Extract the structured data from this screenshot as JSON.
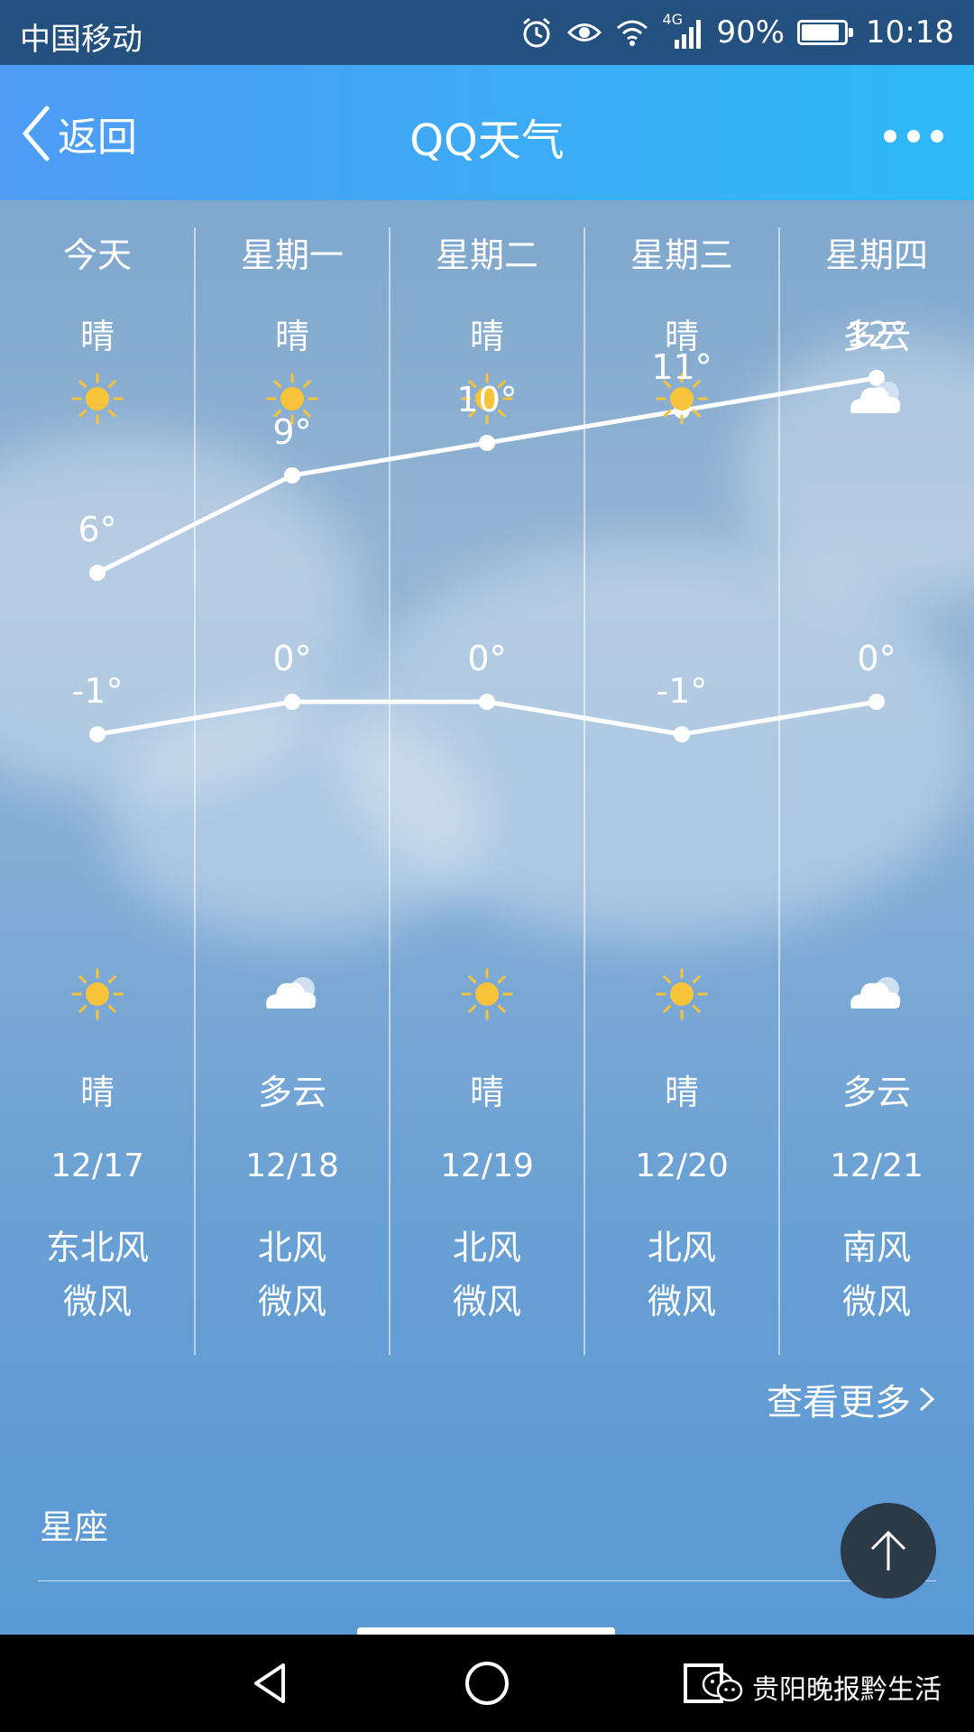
{
  "status_bar": {
    "carrier": "中国移动",
    "network": "4G",
    "battery": "90%",
    "battery_level": 0.9,
    "time": "10:18"
  },
  "app_bar": {
    "back_label": "返回",
    "title": "QQ天气"
  },
  "forecast": [
    {
      "day": "今天",
      "cond_day": "晴",
      "icon_day": "sun-icon",
      "high": "6°",
      "low": "-1°",
      "icon_night": "sun-icon",
      "cond_night": "晴",
      "date": "12/17",
      "wind_dir": "东北风",
      "wind_level": "微风"
    },
    {
      "day": "星期一",
      "cond_day": "晴",
      "icon_day": "sun-icon",
      "high": "9°",
      "low": "0°",
      "icon_night": "cloud-icon",
      "cond_night": "多云",
      "date": "12/18",
      "wind_dir": "北风",
      "wind_level": "微风"
    },
    {
      "day": "星期二",
      "cond_day": "晴",
      "icon_day": "sun-icon",
      "high": "10°",
      "low": "0°",
      "icon_night": "sun-icon",
      "cond_night": "晴",
      "date": "12/19",
      "wind_dir": "北风",
      "wind_level": "微风"
    },
    {
      "day": "星期三",
      "cond_day": "晴",
      "icon_day": "sun-icon",
      "high": "11°",
      "low": "-1°",
      "icon_night": "sun-icon",
      "cond_night": "晴",
      "date": "12/20",
      "wind_dir": "北风",
      "wind_level": "微风"
    },
    {
      "day": "星期四",
      "cond_day": "多云",
      "icon_day": "cloud-icon",
      "high": "12°",
      "low": "0°",
      "icon_night": "cloud-icon",
      "cond_night": "多云",
      "date": "12/21",
      "wind_dir": "南风",
      "wind_level": "微风"
    }
  ],
  "chart_data": {
    "type": "line",
    "categories": [
      "今天",
      "星期一",
      "星期二",
      "星期三",
      "星期四"
    ],
    "series": [
      {
        "values": [
          6,
          9,
          10,
          11,
          12
        ]
      },
      {
        "values": [
          -1,
          0,
          0,
          -1,
          0
        ]
      }
    ]
  },
  "more_link": "查看更多",
  "section": {
    "title": "星座"
  },
  "watermark": "贵阳晚报黔生活",
  "colors": {
    "sun": "#f7c33a",
    "appbar_start": "#4f9cf4",
    "appbar_end": "#2db9f7",
    "status_bar": "#24507f"
  }
}
